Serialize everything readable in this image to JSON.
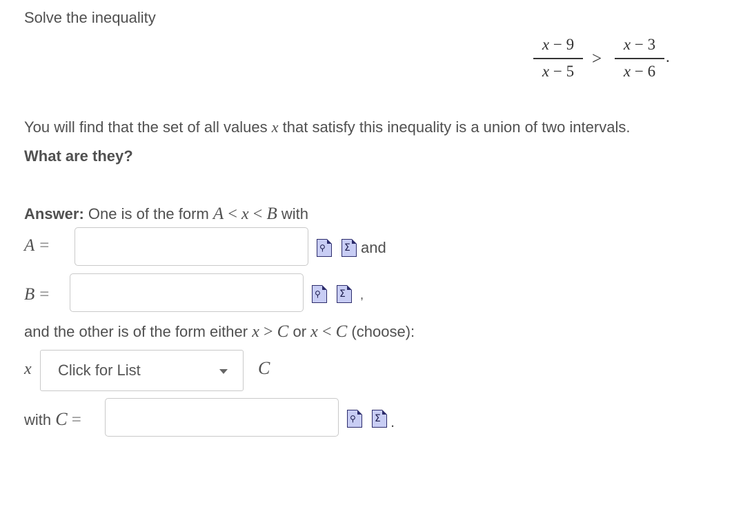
{
  "problem": {
    "intro": "Solve the inequality",
    "lhs_num_var": "x",
    "lhs_num_rest": "− 9",
    "lhs_den_var": "x",
    "lhs_den_rest": "− 5",
    "relation": ">",
    "rhs_num_var": "x",
    "rhs_num_rest": "− 3",
    "rhs_den_var": "x",
    "rhs_den_rest": "− 6",
    "end_period": ".",
    "desc_part1": "You will find that the set of all values",
    "desc_var": "x",
    "desc_part2": "that satisfy this inequality is a union of two intervals.",
    "question": "What are they?"
  },
  "answer": {
    "label": "Answer:",
    "form_text": "One is of the form",
    "form_A": "A",
    "form_lt1": "<",
    "form_x": "x",
    "form_lt2": "<",
    "form_B": "B",
    "form_with": "with",
    "A_var": "A",
    "A_eq": "=",
    "A_value": "",
    "A_after": "and",
    "B_var": "B",
    "B_eq": "=",
    "B_value": "",
    "B_after": ",",
    "other_text1": "and the other is of the form either",
    "other_x1": "x",
    "other_gt": ">",
    "other_C1": "C",
    "other_or": "or",
    "other_x2": "x",
    "other_lt": "<",
    "other_C2": "C",
    "other_choose": "(choose):",
    "sel_x": "x",
    "select_placeholder": "Click for List",
    "sel_C": "C",
    "with_text": "with",
    "C_var": "C",
    "C_eq": "=",
    "C_value": "",
    "C_after": "."
  },
  "icons": {
    "preview": "preview-icon",
    "equation_editor": "equation-editor-icon"
  }
}
